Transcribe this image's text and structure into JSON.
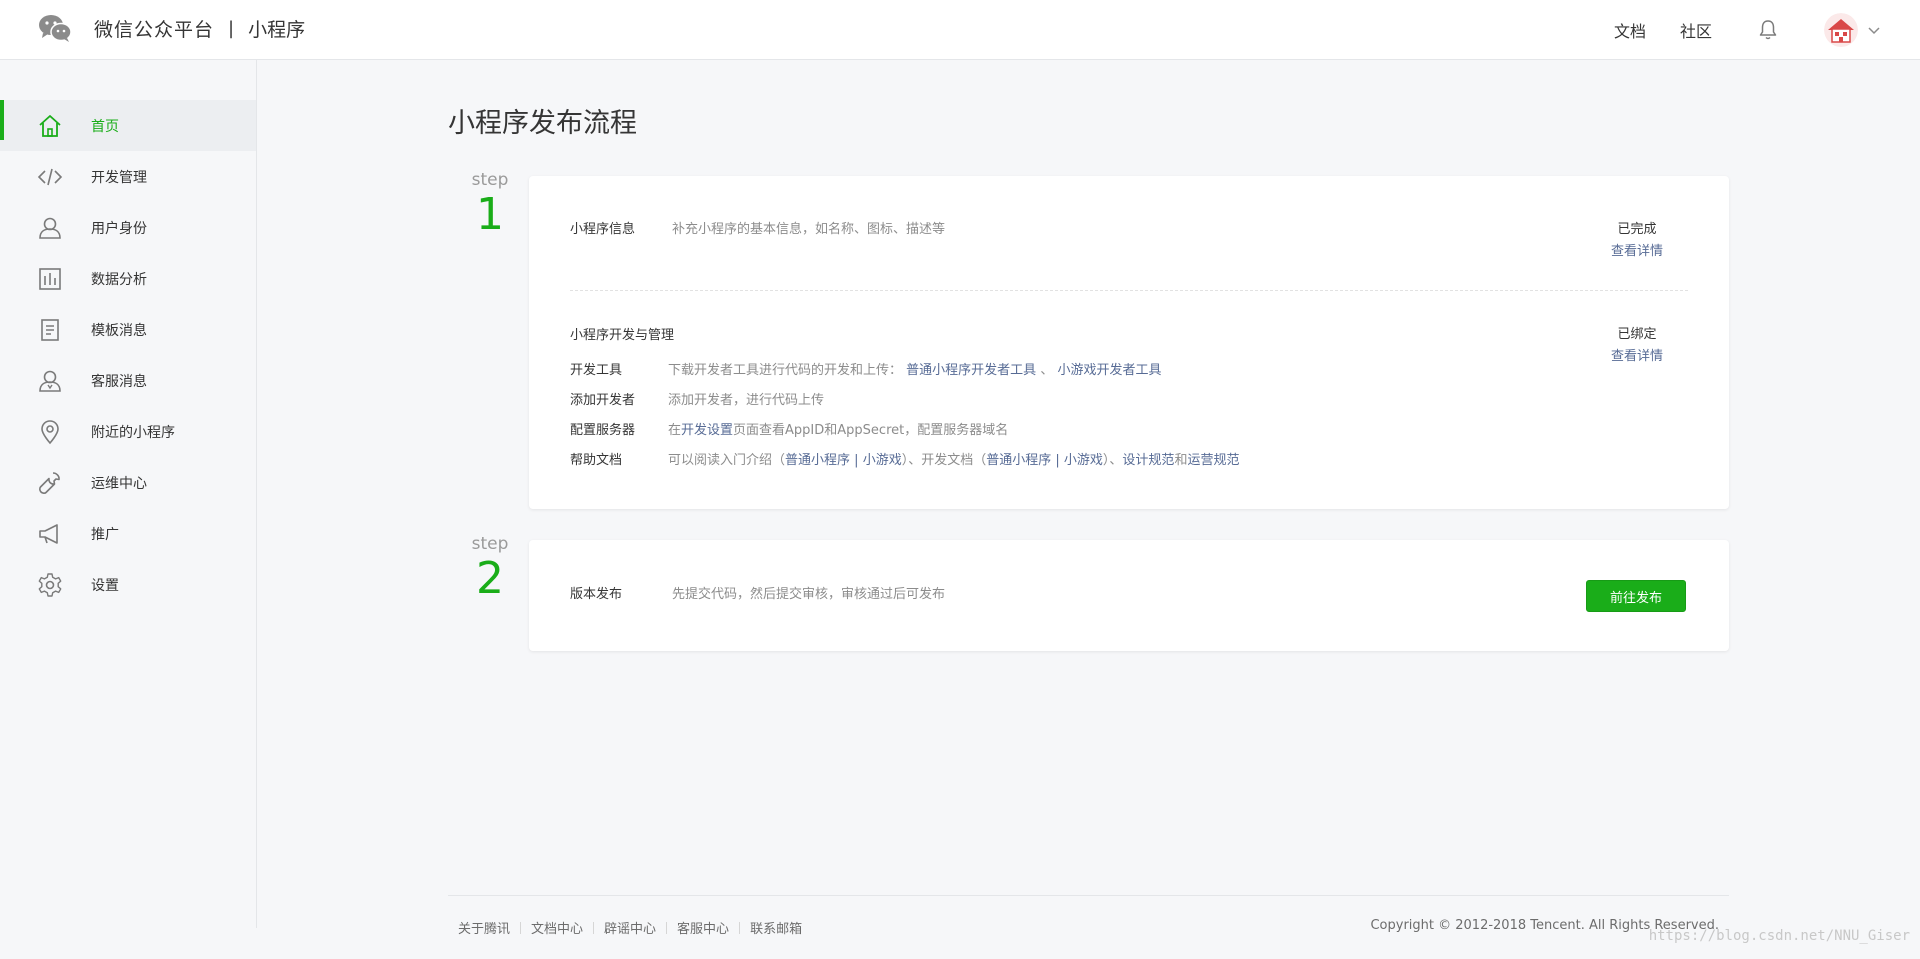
{
  "header": {
    "brand_name": "微信公众平台",
    "brand_sep": "|",
    "brand_sub": "小程序",
    "links": [
      "文档",
      "社区"
    ],
    "icons": [
      "wechat-logo",
      "bell-icon",
      "avatar",
      "chevron-down-icon"
    ]
  },
  "sidebar": {
    "items": [
      {
        "label": "首页",
        "icon": "home-icon",
        "active": true
      },
      {
        "label": "开发管理",
        "icon": "code-icon"
      },
      {
        "label": "用户身份",
        "icon": "user-icon"
      },
      {
        "label": "数据分析",
        "icon": "chart-icon"
      },
      {
        "label": "模板消息",
        "icon": "document-icon"
      },
      {
        "label": "客服消息",
        "icon": "support-icon"
      },
      {
        "label": "附近的小程序",
        "icon": "location-icon"
      },
      {
        "label": "运维中心",
        "icon": "wrench-icon"
      },
      {
        "label": "推广",
        "icon": "megaphone-icon"
      },
      {
        "label": "设置",
        "icon": "gear-icon"
      }
    ],
    "active_color": "#1aad19"
  },
  "main": {
    "title": "小程序发布流程",
    "step_word": "step",
    "step1": {
      "number": "1",
      "info_title": "小程序信息",
      "info_desc": "补充小程序的基本信息，如名称、图标、描述等",
      "info_status": "已完成",
      "info_link": "查看详情",
      "dev_title": "小程序开发与管理",
      "dev_status": "已绑定",
      "dev_link": "查看详情",
      "rows": {
        "tools_label": "开发工具",
        "tools_text": "下载开发者工具进行代码的开发和上传：",
        "tools_link1": "普通小程序开发者工具",
        "tools_sep": "、",
        "tools_link2": "小游戏开发者工具",
        "add_label": "添加开发者",
        "add_text": "添加开发者，进行代码上传",
        "server_label": "配置服务器",
        "server_pre": "在",
        "server_link": "开发设置",
        "server_post": "页面查看AppID和AppSecret，配置服务器域名",
        "help_label": "帮助文档",
        "help_pre": "可以阅读入门介绍（",
        "help_link1": "普通小程序",
        "help_bar1": " | ",
        "help_link2": "小游戏",
        "help_mid": "）、开发文档（",
        "help_link3": "普通小程序",
        "help_bar2": " | ",
        "help_link4": "小游戏",
        "help_mid2": "）、",
        "help_link5": "设计规范",
        "help_and": "和",
        "help_link6": "运营规范"
      }
    },
    "step2": {
      "number": "2",
      "title": "版本发布",
      "desc": "先提交代码，然后提交审核，审核通过后可发布",
      "button": "前往发布"
    }
  },
  "footer": {
    "links": [
      "关于腾讯",
      "文档中心",
      "辟谣中心",
      "客服中心",
      "联系邮箱"
    ],
    "copyright": "Copyright © 2012-2018 Tencent. All Rights Reserved.",
    "watermark": "https://blog.csdn.net/NNU_Giser"
  }
}
